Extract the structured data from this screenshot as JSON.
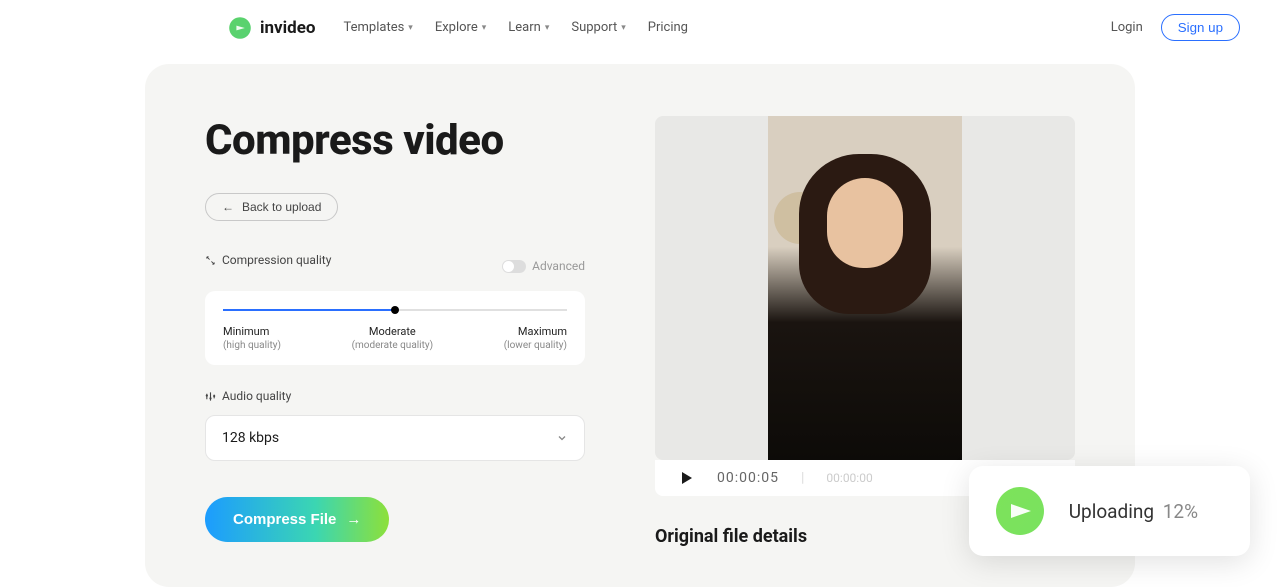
{
  "nav": {
    "brand": "invideo",
    "items": [
      {
        "label": "Templates",
        "hasDropdown": true
      },
      {
        "label": "Explore",
        "hasDropdown": true
      },
      {
        "label": "Learn",
        "hasDropdown": true
      },
      {
        "label": "Support",
        "hasDropdown": true
      },
      {
        "label": "Pricing",
        "hasDropdown": false
      }
    ],
    "login": "Login",
    "signup": "Sign up"
  },
  "page": {
    "title": "Compress video",
    "back": "Back to upload",
    "compressionLabel": "Compression quality",
    "advanced": "Advanced",
    "slider": {
      "min": {
        "main": "Minimum",
        "sub": "(high quality)"
      },
      "mid": {
        "main": "Moderate",
        "sub": "(moderate quality)"
      },
      "max": {
        "main": "Maximum",
        "sub": "(lower quality)"
      }
    },
    "audioLabel": "Audio quality",
    "audioValue": "128 kbps",
    "compressBtn": "Compress File"
  },
  "preview": {
    "currentTime": "00:00:05",
    "duration": "00:00:00"
  },
  "details": {
    "title": "Original file details"
  },
  "upload": {
    "label": "Uploading",
    "percent": "12%"
  }
}
